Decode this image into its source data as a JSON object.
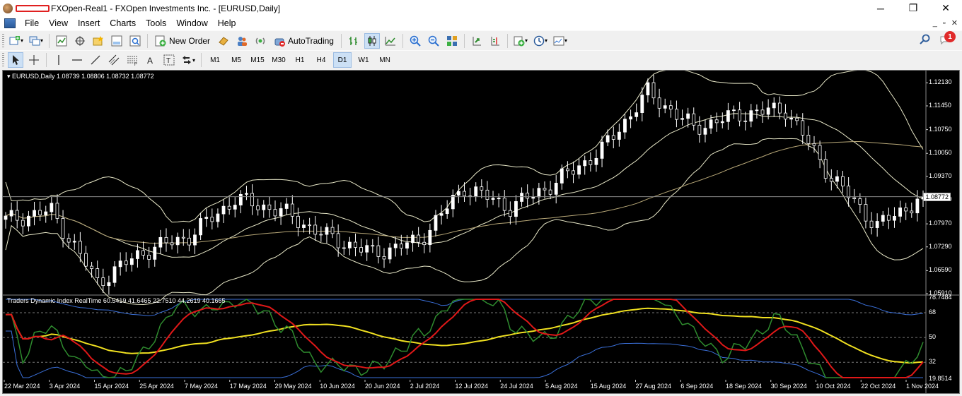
{
  "window": {
    "title": "FXOpen-Real1 - FXOpen Investments Inc. - [EURUSD,Daily]",
    "minimize": "─",
    "maximize": "❐",
    "close": "✕"
  },
  "menu": {
    "items": [
      "File",
      "View",
      "Insert",
      "Charts",
      "Tools",
      "Window",
      "Help"
    ],
    "mdi": [
      "_",
      "▫",
      "✕"
    ]
  },
  "toolbar": {
    "new_order_label": "New Order",
    "autotrading_label": "AutoTrading",
    "notification_count": "1",
    "timeframes": [
      "M1",
      "M5",
      "M15",
      "M30",
      "H1",
      "H4",
      "D1",
      "W1",
      "MN"
    ],
    "active_timeframe": "D1"
  },
  "chart": {
    "header": "EURUSD,Daily  1.08739 1.08806 1.08732 1.08772",
    "indicator_header": "Traders Dynamic Index RealTime 60.5419 41.6465 22.7510 44.2619 40.1665",
    "current_price": "1.08772",
    "price_axis": [
      "1.12130",
      "1.11450",
      "1.10750",
      "1.10050",
      "1.09370",
      "1.08670",
      "1.07970",
      "1.07290",
      "1.06590",
      "1.05910"
    ],
    "indicator_axis": [
      "78.7484",
      "68",
      "50",
      "32",
      "19.8514"
    ],
    "date_axis": [
      "22 Mar 2024",
      "3 Apr 2024",
      "15 Apr 2024",
      "25 Apr 2024",
      "7 May 2024",
      "17 May 2024",
      "29 May 2024",
      "10 Jun 2024",
      "20 Jun 2024",
      "2 Jul 2024",
      "12 Jul 2024",
      "24 Jul 2024",
      "5 Aug 2024",
      "15 Aug 2024",
      "27 Aug 2024",
      "6 Sep 2024",
      "18 Sep 2024",
      "30 Sep 2024",
      "10 Oct 2024",
      "22 Oct 2024",
      "1 Nov 2024"
    ],
    "colors": {
      "bg": "#000000",
      "candle": "#ffffff",
      "bands": "#e8e8c8",
      "tdi_volatility": "#3a6fd8",
      "tdi_price_line": "#2e8b2e",
      "tdi_signal": "#e01818",
      "tdi_market_base": "#f0e020"
    }
  },
  "chart_data": {
    "type": "candlestick",
    "symbol": "EURUSD",
    "timeframe": "Daily",
    "ylim": [
      1.0591,
      1.1245
    ],
    "close_anchors": [
      [
        "22 Mar 2024",
        1.0808
      ],
      [
        "3 Apr 2024",
        1.0835
      ],
      [
        "15 Apr 2024",
        1.0625
      ],
      [
        "25 Apr 2024",
        1.0715
      ],
      [
        "7 May 2024",
        1.076
      ],
      [
        "17 May 2024",
        1.087
      ],
      [
        "29 May 2024",
        1.0835
      ],
      [
        "10 Jun 2024",
        1.076
      ],
      [
        "20 Jun 2024",
        1.071
      ],
      [
        "2 Jul 2024",
        1.0745
      ],
      [
        "12 Jul 2024",
        1.0905
      ],
      [
        "24 Jul 2024",
        1.0845
      ],
      [
        "5 Aug 2024",
        1.092
      ],
      [
        "15 Aug 2024",
        1.1015
      ],
      [
        "27 Aug 2024",
        1.1185
      ],
      [
        "6 Sep 2024",
        1.108
      ],
      [
        "18 Sep 2024",
        1.112
      ],
      [
        "30 Sep 2024",
        1.1135
      ],
      [
        "10 Oct 2024",
        1.0935
      ],
      [
        "22 Oct 2024",
        1.079
      ],
      [
        "1 Nov 2024",
        1.0877
      ]
    ],
    "indicator": {
      "name": "Traders Dynamic Index RealTime",
      "values": [
        60.5419,
        41.6465,
        22.751,
        44.2619,
        40.1665
      ],
      "ylim": [
        19.8514,
        78.7484
      ],
      "levels": [
        68,
        50,
        32
      ]
    }
  }
}
